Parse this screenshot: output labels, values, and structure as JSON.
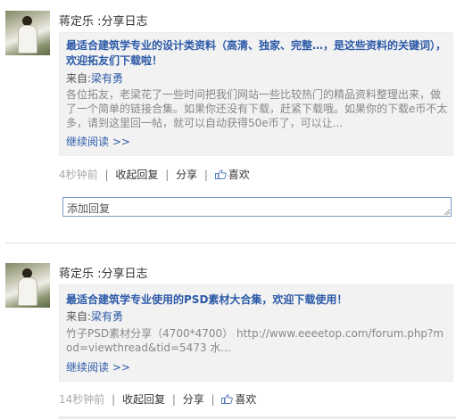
{
  "posts": [
    {
      "user": "蒋定乐",
      "action": " :分享日志",
      "title": "最适合建筑学专业的设计类资料（高清、独家、完整…，是这些资料的关键词），欢迎拓友们下载啦！",
      "from_prefix": "来自:",
      "from_name": "梁有勇",
      "excerpt": "各位拓友，老梁花了一些时间把我们网站一些比较热门的精品资料整理出来，做了一个简单的链接合集。如果你还没有下载，赶紧下载哦。如果你的下载e币不太多，请到这里回一帖，就可以自动获得50e币了，可以让...",
      "more": "继续阅读 >>",
      "time": "4秒钟前",
      "fold_reply": "收起回复",
      "share": "分享",
      "like": "喜欢",
      "reply_placeholder": "添加回复"
    },
    {
      "user": "蒋定乐",
      "action": " :分享日志",
      "title": "最适合建筑学专业使用的PSD素材大合集，欢迎下载使用！",
      "from_prefix": "来自:",
      "from_name": "梁有勇",
      "excerpt": "竹子PSD素材分享（4700*4700） http://www.eeeetop.com/forum.php?mod=viewthread&tid=5473 水...",
      "more": "继续阅读 >>",
      "time": "14秒钟前",
      "fold_reply": "收起回复",
      "share": "分享",
      "like": "喜欢"
    }
  ],
  "colors": {
    "link": "#2c5aa8",
    "card_bg": "#f2f2f2",
    "input_border": "#7a9cc6"
  },
  "icons": {
    "like": "thumbs-up-icon",
    "resize": "resize-grip-icon"
  }
}
